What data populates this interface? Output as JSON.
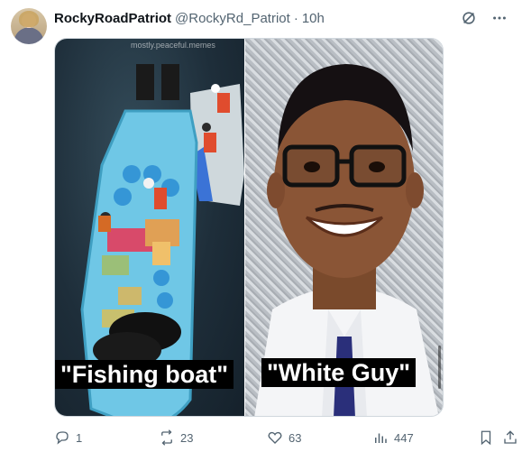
{
  "post": {
    "display_name": "RockyRoadPatriot",
    "handle": "@RockyRd_Patriot",
    "separator": "·",
    "time": "10h"
  },
  "media": {
    "watermark": "mostly.peaceful.memes",
    "left_caption": "\"Fishing boat\"",
    "right_caption": "\"White Guy\""
  },
  "actions": {
    "replies": "1",
    "reposts": "23",
    "likes": "63",
    "views": "447"
  },
  "icons": {
    "grok": "grok-icon",
    "more": "more-icon",
    "reply": "reply-icon",
    "repost": "repost-icon",
    "like": "heart-icon",
    "views": "views-icon",
    "bookmark": "bookmark-icon",
    "share": "share-icon"
  },
  "colors": {
    "text_primary": "#0f1419",
    "text_secondary": "#536471",
    "caption_bg": "#000000",
    "boat_hull": "#6fc7e6"
  }
}
